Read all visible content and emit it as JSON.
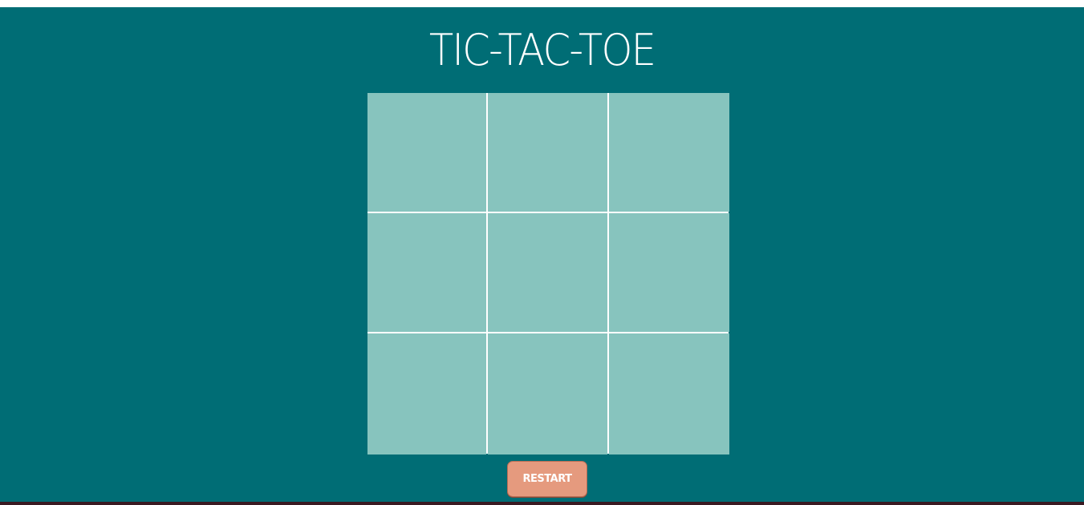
{
  "game": {
    "title": "TIC-TAC-TOE",
    "board": {
      "cells": [
        "",
        "",
        "",
        "",
        "",
        "",
        "",
        "",
        ""
      ]
    },
    "restart_label": "RESTART"
  },
  "colors": {
    "background": "#006d75",
    "cell": "#87c4be",
    "grid_lines": "#ffffff",
    "restart_button": "#e59a7e",
    "text": "#ffffff"
  }
}
